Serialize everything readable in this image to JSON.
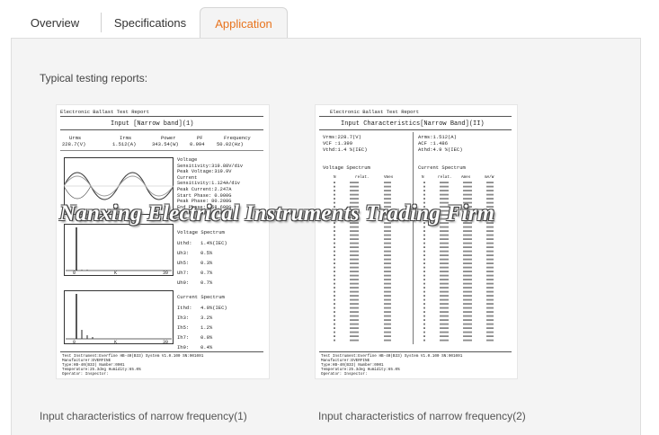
{
  "tabs": [
    {
      "label": "Overview"
    },
    {
      "label": "Specifications"
    },
    {
      "label": "Application"
    }
  ],
  "section_title": "Typical testing reports:",
  "watermark": "Nanxing Electrical Instruments Trading Firm",
  "report1": {
    "header": "Electronic Ballast Test Report",
    "title": "Input [Narrow band](1)",
    "col_heads": [
      "Urms",
      "Irms",
      "Power",
      "PF",
      "Frequency"
    ],
    "col_vals": [
      "228.7(V)",
      "1.512(A)",
      "343.54(W)",
      "0.994",
      "50.02(Hz)"
    ],
    "wave_info": [
      "Voltage",
      "Sensitivity:319.88V/div",
      "Peak Voltage:319.9V",
      "Current",
      "Sensitivity:1.124A/div",
      "Peak Current:2.247A",
      "Start Phase: 0.000G",
      "Peak Phase: 80.208G",
      "End Phase: 358.608G"
    ],
    "vspec_title": "Voltage Spectrum",
    "vspec_rows": [
      [
        "Uthd:",
        "1.4%(IEC)"
      ],
      [
        "Uh3:",
        "0.5%"
      ],
      [
        "Uh5:",
        "0.3%"
      ],
      [
        "Uh7:",
        "0.7%"
      ],
      [
        "Uh9:",
        "0.7%"
      ]
    ],
    "ispec_title": "Current Spectrum",
    "ispec_rows": [
      [
        "Ithd:",
        "4.9%(IEC)"
      ],
      [
        "Ih3:",
        "3.2%"
      ],
      [
        "Ih5:",
        "1.2%"
      ],
      [
        "Ih7:",
        "0.9%"
      ],
      [
        "Ih9:",
        "0.4%"
      ]
    ],
    "axis_labels": [
      "0",
      "K",
      "39"
    ],
    "footer": [
      "Test Instrument:Everfine HB-40(B33) System V1.0.100 SN:001001",
      "Manufacturer:EVERFINE",
      "Type:HB-40(B33)        Number:0001",
      "Temperature:25.3deg    Humidity:65.0%",
      "Operator:              Inspector:"
    ]
  },
  "report2": {
    "header": "Electronic Ballast Test Report",
    "title": "Input Characteristics[Narrow Band](II)",
    "left_info": [
      "Vrms:228.7(V)",
      "VCF :1.399",
      "Vthd:1.4  %(IEC)"
    ],
    "right_info": [
      "Arms:1.512(A)",
      "ACF :1.486",
      "Athd:4.9  %(IEC)"
    ],
    "vspec_title": "Voltage Spectrum",
    "ispec_title": "Current Spectrum",
    "vspec_head": [
      "N",
      "relat.",
      "Vmes"
    ],
    "ispec_head": [
      "N",
      "relat.",
      "Ames",
      "mA/W"
    ],
    "footer": [
      "Test Instrument:Everfine HB-40(B33) System V1.0.100 SN:001001",
      "Manufacturer:EVERFINE",
      "Type:HB-40(B33)        Number:0001",
      "Temperature:25.3deg    Humidity:65.0%",
      "Operator:              Inspector:"
    ]
  },
  "captions": [
    "Input characteristics of narrow frequency(1)",
    "Input characteristics of narrow frequency(2)"
  ]
}
